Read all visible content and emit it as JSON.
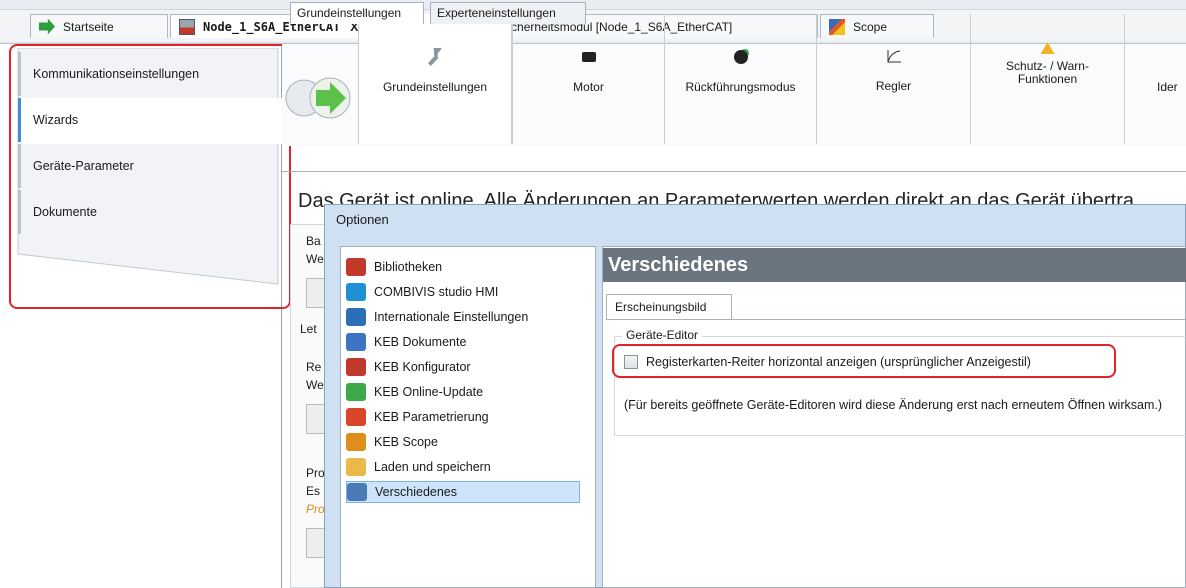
{
  "doc_tabs": [
    {
      "label": "Startseite",
      "icon": "green-arrow-icon"
    },
    {
      "label": "Node_1_S6A_EtherCAT",
      "icon": "keb-device-icon",
      "close": "X"
    },
    {
      "label": "KEB Sicherheitsmodul [Node_1_S6A_EtherCAT]",
      "icon": "shield-icon"
    },
    {
      "label": "Scope",
      "icon": "scope-icon"
    }
  ],
  "nav": {
    "items": [
      {
        "label": "Kommunikationseinstellungen"
      },
      {
        "label": "Wizards"
      },
      {
        "label": "Geräte-Parameter"
      },
      {
        "label": "Dokumente"
      }
    ]
  },
  "toolbar": {
    "items": [
      {
        "label": "Grundeinstellungen",
        "icon": "wrench-icon"
      },
      {
        "label": "Motor",
        "icon": "motor-icon"
      },
      {
        "label": "Rückführungsmodus",
        "icon": "encoder-icon"
      },
      {
        "label": "Regler",
        "icon": "curve-icon"
      },
      {
        "label": "Schutz- / Warn-\nFunktionen",
        "icon": "warning-icon"
      },
      {
        "label": "Ider",
        "icon": ""
      }
    ]
  },
  "inner_tabs": [
    "Grundeinstellungen",
    "Experteneinstellungen"
  ],
  "background": {
    "banner": "Das Gerät ist online. Alle Änderungen an Parameterwerten werden direkt an das Gerät übertra",
    "fragments": [
      "Ba",
      "We",
      "Let",
      "Re",
      "We",
      "Pro",
      "Es",
      "Pro"
    ]
  },
  "dialog": {
    "title": "Optionen",
    "tree": [
      {
        "label": "Bibliotheken",
        "icon": "books-icon",
        "color": "#c0392b"
      },
      {
        "label": "COMBIVIS studio HMI",
        "icon": "hmi-icon",
        "color": "#1f8fd6"
      },
      {
        "label": "Internationale Einstellungen",
        "icon": "globe-icon",
        "color": "#2c6fb8"
      },
      {
        "label": "KEB Dokumente",
        "icon": "book-icon",
        "color": "#3a74c2"
      },
      {
        "label": "KEB Konfigurator",
        "icon": "keb-config-icon",
        "color": "#c0392b"
      },
      {
        "label": "KEB Online-Update",
        "icon": "update-icon",
        "color": "#3ea84a"
      },
      {
        "label": "KEB Parametrierung",
        "icon": "param-icon",
        "color": "#d9472b"
      },
      {
        "label": "KEB Scope",
        "icon": "scope-icon",
        "color": "#e08e1b"
      },
      {
        "label": "Laden und speichern",
        "icon": "folder-icon",
        "color": "#e9b949"
      },
      {
        "label": "Verschiedenes",
        "icon": "list-icon",
        "color": "#4a7bb7"
      }
    ],
    "selected": "Verschiedenes",
    "panel": {
      "heading": "Verschiedenes",
      "tab": "Erscheinungsbild",
      "group": "Geräte-Editor",
      "checkbox_label": "Registerkarten-Reiter horizontal anzeigen (ursprünglicher Anzeigestil)",
      "checked": false,
      "note": "(Für bereits geöffnete Geräte-Editoren wird diese Änderung erst nach erneutem Öffnen wirksam.)"
    }
  }
}
